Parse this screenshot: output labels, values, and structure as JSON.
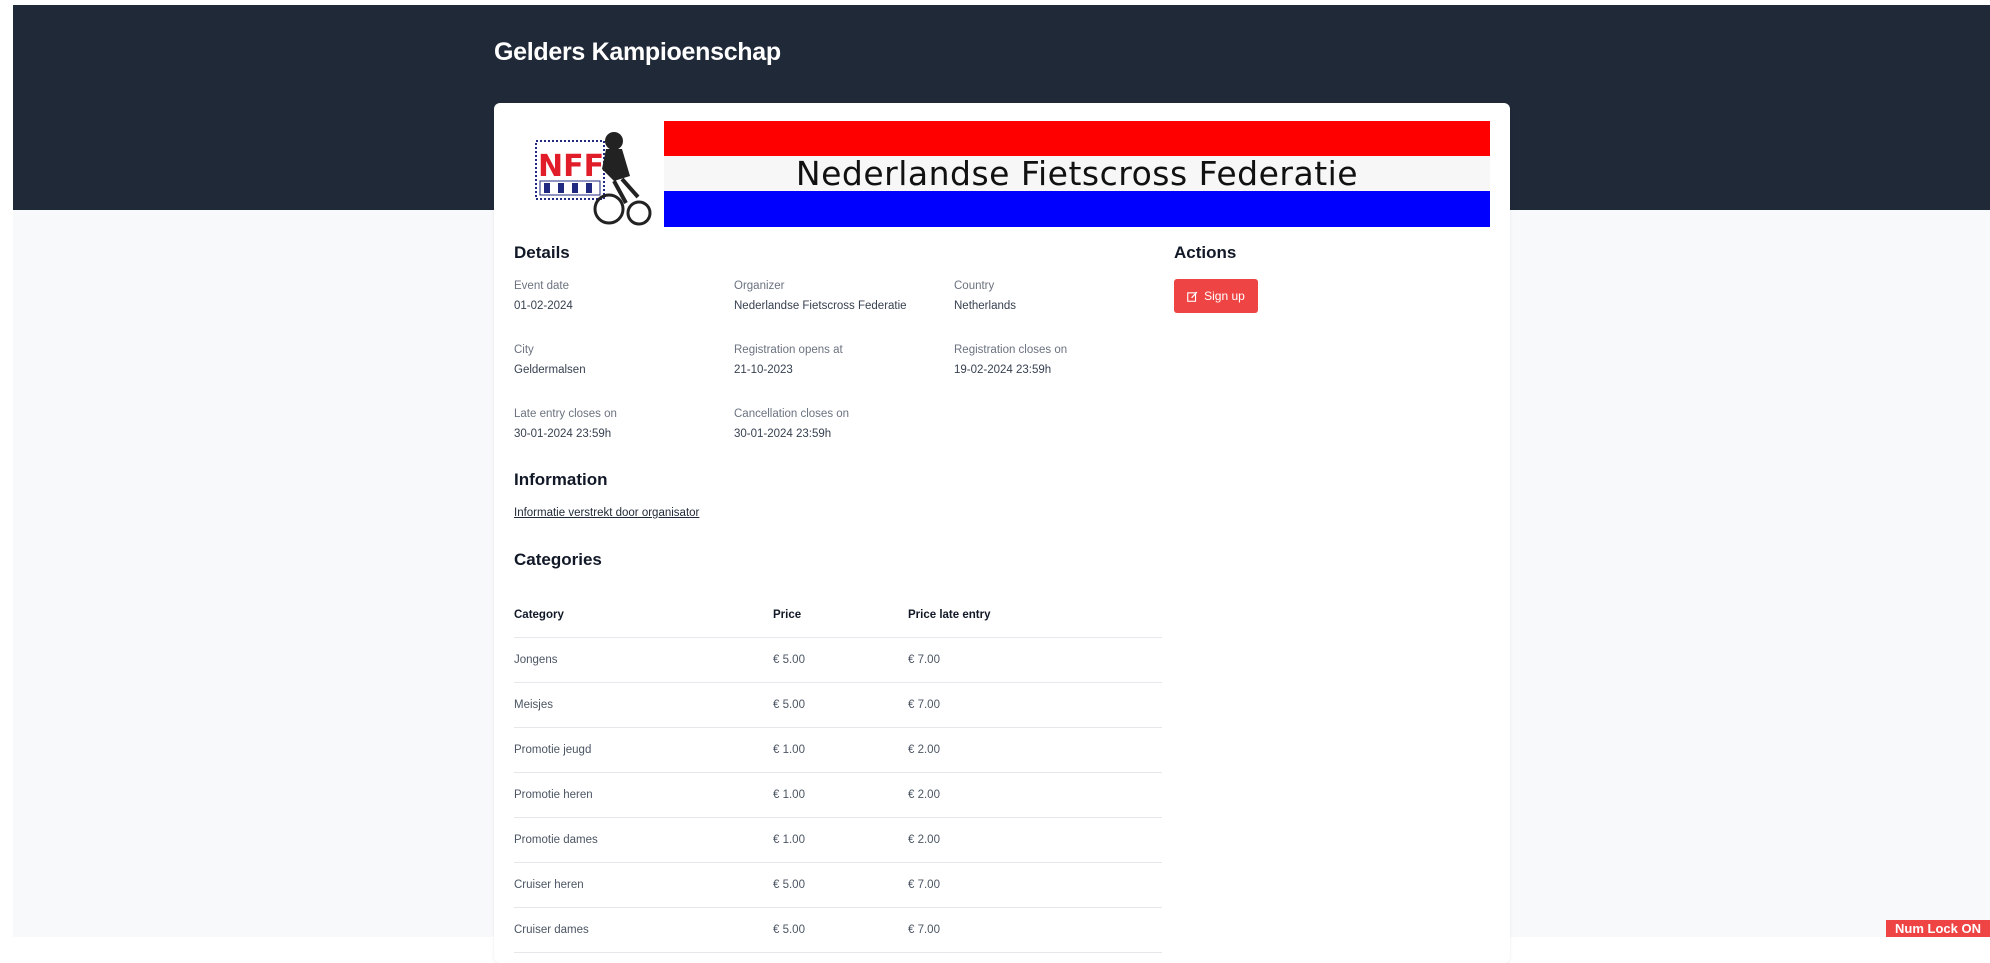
{
  "event": {
    "title": "Gelders Kampioenschap",
    "banner_text": "Nederlandse Fietscross Federatie",
    "logo_text": "NFF"
  },
  "details": {
    "heading": "Details",
    "fields": [
      {
        "label": "Event date",
        "value": "01-02-2024"
      },
      {
        "label": "Organizer",
        "value": "Nederlandse Fietscross Federatie"
      },
      {
        "label": "Country",
        "value": "Netherlands"
      },
      {
        "label": "City",
        "value": "Geldermalsen"
      },
      {
        "label": "Registration opens at",
        "value": "21-10-2023"
      },
      {
        "label": "Registration closes on",
        "value": "19-02-2024 23:59h"
      },
      {
        "label": "Late entry closes on",
        "value": "30-01-2024 23:59h"
      },
      {
        "label": "Cancellation closes on",
        "value": "30-01-2024 23:59h"
      }
    ]
  },
  "actions": {
    "heading": "Actions",
    "signup_label": "Sign up",
    "signup_icon": "edit-icon"
  },
  "information": {
    "heading": "Information",
    "link_text": "Informatie verstrekt door organisator"
  },
  "categories": {
    "heading": "Categories",
    "columns": [
      "Category",
      "Price",
      "Price late entry"
    ],
    "rows": [
      [
        "Jongens",
        "€ 5.00",
        "€ 7.00"
      ],
      [
        "Meisjes",
        "€ 5.00",
        "€ 7.00"
      ],
      [
        "Promotie jeugd",
        "€ 1.00",
        "€ 2.00"
      ],
      [
        "Promotie heren",
        "€ 1.00",
        "€ 2.00"
      ],
      [
        "Promotie dames",
        "€ 1.00",
        "€ 2.00"
      ],
      [
        "Cruiser heren",
        "€ 5.00",
        "€ 7.00"
      ],
      [
        "Cruiser dames",
        "€ 5.00",
        "€ 7.00"
      ]
    ]
  },
  "overlay": {
    "numlock_text": "Num Lock ON"
  },
  "colors": {
    "header_bg": "#202938",
    "accent": "#ef4444",
    "flag_red": "#ff0000",
    "flag_blue": "#0000ff"
  }
}
